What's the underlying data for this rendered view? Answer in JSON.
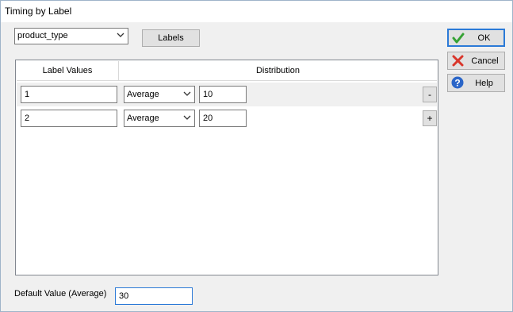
{
  "window": {
    "title": "Timing by Label"
  },
  "label_select": {
    "value": "product_type"
  },
  "labels_button": {
    "label": "Labels"
  },
  "grid": {
    "headers": [
      "Label Values",
      "Distribution"
    ],
    "rows": [
      {
        "label_value": "1",
        "distribution": "Average",
        "amount": "10",
        "action": "-"
      },
      {
        "label_value": "2",
        "distribution": "Average",
        "amount": "20",
        "action": "+"
      }
    ]
  },
  "buttons": {
    "ok": "OK",
    "cancel": "Cancel",
    "help": "Help"
  },
  "default_value": {
    "label": "Default Value (Average)",
    "value": "30"
  },
  "icons": {
    "ok": "check-icon",
    "cancel": "red-x-icon",
    "help": "question-icon",
    "chevron": "chevron-down-icon"
  },
  "colors": {
    "accent": "#2b7ad7",
    "ok_check": "#36a234",
    "cancel_x": "#d9362b",
    "help_blue": "#2a65c8"
  }
}
